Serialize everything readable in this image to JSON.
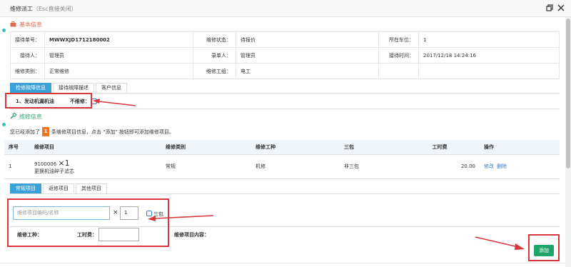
{
  "window": {
    "title": "维修派工",
    "hint": "（Esc直接关闭）"
  },
  "basic_info": {
    "heading": "基本信息",
    "rows": [
      [
        {
          "label": "接待单号：",
          "value": "MWWXJD1712180002",
          "bold": true
        },
        {
          "label": "维修状态：",
          "value": "待报价"
        },
        {
          "label": "所在车位：",
          "value": "1"
        }
      ],
      [
        {
          "label": "接待人：",
          "value": "管理员"
        },
        {
          "label": "录单人：",
          "value": "管理员"
        },
        {
          "label": "接待时间：",
          "value": "2017/12/18 14:24:16"
        }
      ],
      [
        {
          "label": "维修类别：",
          "value": "正常维修"
        },
        {
          "label": "维修工组：",
          "value": "电工"
        },
        {
          "label": "",
          "value": ""
        }
      ]
    ]
  },
  "top_tabs": [
    "检修故障信息",
    "接待故障描述",
    "客户信息"
  ],
  "fault": {
    "text": "1、发动机漏机油",
    "no_repair_label": "不维修："
  },
  "repair_info": {
    "heading": "维修信息",
    "added_prefix": "您已经添加了",
    "added_count": "1",
    "added_suffix": "条维修项目信息，点击 \"添加\" 按钮即可添加维修项目。"
  },
  "items_table": {
    "headers": [
      "序号",
      "维修项目",
      "维修类别",
      "维修工种",
      "三包",
      "工时费",
      "操作"
    ],
    "rows": [
      {
        "no": "1",
        "code": "9100006",
        "qty": "×1",
        "name": "更换机油碎子滤芯",
        "category": "常规",
        "trade": "机修",
        "warranty": "非三包",
        "cost": "20.00",
        "edit": "修改",
        "delete": "删除"
      }
    ]
  },
  "bottom_tabs": [
    "常规项目",
    "返修项目",
    "其他项目"
  ],
  "form": {
    "item_placeholder": "维修项目编码/名称",
    "times": "×",
    "qty_value": "1",
    "warranty_label": "三包",
    "trade_label": "维修工种：",
    "cost_label": "工时费：",
    "content_label": "维修项目内容：",
    "add_button": "添加"
  },
  "colors": {
    "accent_blue": "#3aa0d8",
    "highlight_red": "#d9363e",
    "add_green": "#1fa56a",
    "badge_orange": "#f0771f"
  }
}
